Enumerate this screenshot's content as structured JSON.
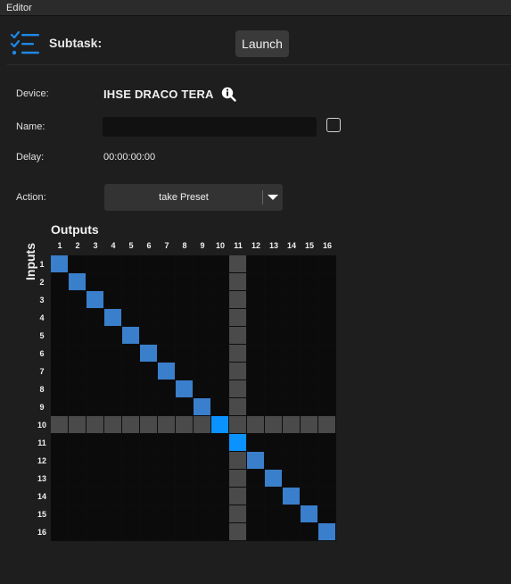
{
  "window": {
    "title": "Editor"
  },
  "header": {
    "subtask_label": "Subtask:",
    "launch_label": "Launch"
  },
  "form": {
    "device_label": "Device:",
    "device_value": "IHSE DRACO TERA",
    "name_label": "Name:",
    "name_value": "",
    "delay_label": "Delay:",
    "delay_value": "00:00:00:00",
    "action_label": "Action:",
    "action_value": "take Preset"
  },
  "matrix": {
    "outputs_label": "Outputs",
    "inputs_label": "Inputs",
    "outputs": [
      "1",
      "2",
      "3",
      "4",
      "5",
      "6",
      "7",
      "8",
      "9",
      "10",
      "11",
      "12",
      "13",
      "14",
      "15",
      "16"
    ],
    "inputs": [
      "1",
      "2",
      "3",
      "4",
      "5",
      "6",
      "7",
      "8",
      "9",
      "10",
      "11",
      "12",
      "13",
      "14",
      "15",
      "16"
    ],
    "disabled_output": 11,
    "disabled_input": 10,
    "connections": [
      {
        "input": 1,
        "output": 1,
        "state": "on"
      },
      {
        "input": 2,
        "output": 2,
        "state": "on"
      },
      {
        "input": 3,
        "output": 3,
        "state": "on"
      },
      {
        "input": 4,
        "output": 4,
        "state": "on"
      },
      {
        "input": 5,
        "output": 5,
        "state": "on"
      },
      {
        "input": 6,
        "output": 6,
        "state": "on"
      },
      {
        "input": 7,
        "output": 7,
        "state": "on"
      },
      {
        "input": 8,
        "output": 8,
        "state": "on"
      },
      {
        "input": 9,
        "output": 9,
        "state": "on"
      },
      {
        "input": 10,
        "output": 10,
        "state": "active"
      },
      {
        "input": 11,
        "output": 11,
        "state": "active"
      },
      {
        "input": 12,
        "output": 12,
        "state": "on"
      },
      {
        "input": 13,
        "output": 13,
        "state": "on"
      },
      {
        "input": 14,
        "output": 14,
        "state": "on"
      },
      {
        "input": 15,
        "output": 15,
        "state": "on"
      },
      {
        "input": 16,
        "output": 16,
        "state": "on"
      }
    ]
  },
  "icons": {
    "task": "task-list-icon",
    "info": "info-magnifier-icon",
    "dropdown": "chevron-down-icon"
  },
  "colors": {
    "background": "#1e1e1e",
    "accent": "#0a92ff",
    "connection": "#3a7fcb",
    "disabled": "#4a4a4a",
    "task_icon": "#1e88e5"
  }
}
